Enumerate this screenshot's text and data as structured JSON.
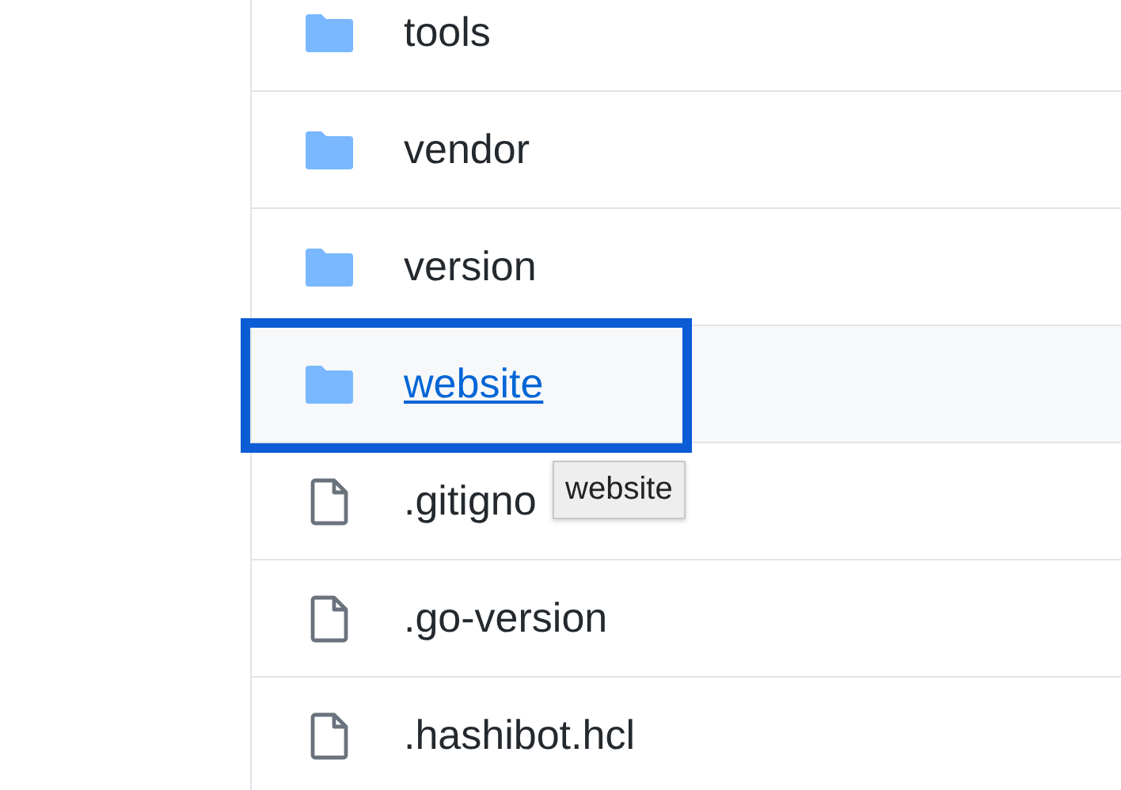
{
  "files": [
    {
      "kind": "folder",
      "name": "tools",
      "hovered": false,
      "outlined": false
    },
    {
      "kind": "folder",
      "name": "vendor",
      "hovered": false,
      "outlined": false
    },
    {
      "kind": "folder",
      "name": "version",
      "hovered": false,
      "outlined": false
    },
    {
      "kind": "folder",
      "name": "website",
      "hovered": true,
      "outlined": true,
      "tooltip": "website"
    },
    {
      "kind": "file",
      "name": ".gitigno",
      "hovered": false,
      "outlined": false
    },
    {
      "kind": "file",
      "name": ".go-version",
      "hovered": false,
      "outlined": false
    },
    {
      "kind": "file",
      "name": ".hashibot.hcl",
      "hovered": false,
      "outlined": false
    }
  ]
}
